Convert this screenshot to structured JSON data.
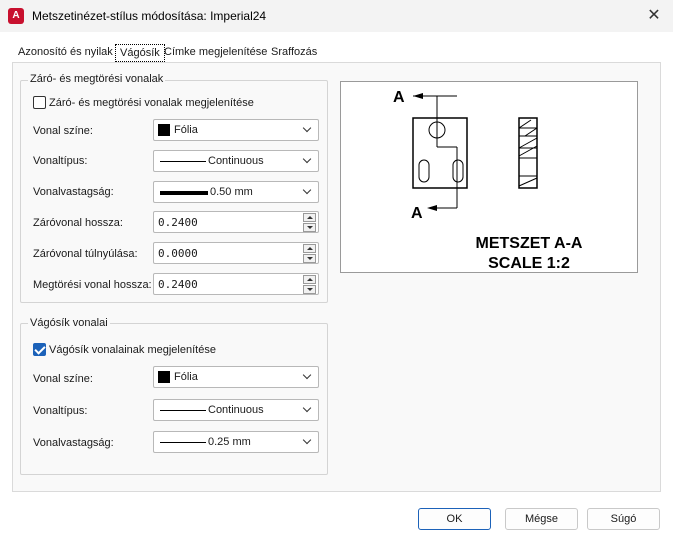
{
  "window": {
    "title": "Metszetinézet-stílus módosítása: Imperial24",
    "app_icon": "A",
    "close_label": "✕"
  },
  "tabs": [
    {
      "label": "Azonosító és nyilak",
      "active": false
    },
    {
      "label": "Vágósík",
      "active": true
    },
    {
      "label": "Címke megjelenítése",
      "active": false
    },
    {
      "label": "Sraffozás",
      "active": false
    }
  ],
  "break_lines": {
    "group_title": "Záró- és megtörési vonalak",
    "show_checkbox_label": "Záró- és megtörési vonalak megjelenítése",
    "show_checked": false,
    "color_label": "Vonal színe:",
    "color_value": "Fólia",
    "linetype_label": "Vonaltípus:",
    "linetype_value": "Continuous",
    "lineweight_label": "Vonalvastagság:",
    "lineweight_value": "0.50 mm",
    "end_length_label": "Záróvonal hossza:",
    "end_length_value": "0.2400",
    "end_extension_label": "Záróvonal túlnyúlása:",
    "end_extension_value": "0.0000",
    "break_length_label": "Megtörési vonal hossza:",
    "break_length_value": "0.2400"
  },
  "plane_lines": {
    "group_title": "Vágósík vonalai",
    "show_checkbox_label": "Vágósík vonalainak megjelenítése",
    "show_checked": true,
    "color_label": "Vonal színe:",
    "color_value": "Fólia",
    "linetype_label": "Vonaltípus:",
    "linetype_value": "Continuous",
    "lineweight_label": "Vonalvastagság:",
    "lineweight_value": "0.25 mm"
  },
  "preview": {
    "marker_top": "A",
    "marker_bottom": "A",
    "caption_line1": "METSZET A-A",
    "caption_line2": "SCALE 1:2"
  },
  "buttons": {
    "ok": "OK",
    "cancel": "Mégse",
    "help": "Súgó"
  },
  "colors": {
    "accent": "#1c62b9",
    "app_icon_bg": "#c8102e",
    "preview_arrow": "#000000"
  }
}
